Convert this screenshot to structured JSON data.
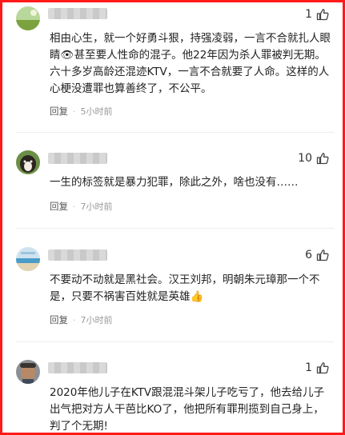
{
  "comments": [
    {
      "likes": "1",
      "text": "相由心生，就一个好勇斗狠，持强凌弱，一言不合就扎人眼睛👁甚至要人性命的混子。他22年因为杀人罪被判无期。六十多岁高龄还混迹KTV，一言不合就要了人命。这样的人心梗没遭罪也算善终了，不公平。",
      "reply": "回复",
      "time": "5小时前"
    },
    {
      "likes": "10",
      "text": "一生的标签就是暴力犯罪，除此之外，啥也没有……",
      "reply": "回复",
      "time": "7小时前"
    },
    {
      "likes": "6",
      "text": "不要动不动就是黑社会。汉王刘邦，明朝朱元璋那一个不是，只要不祸害百姓就是英雄👍",
      "reply": "回复",
      "time": "7小时前"
    },
    {
      "likes": "1",
      "text": "2020年他儿子在KTV跟混混斗架儿子吃亏了，他去给儿子出气把对方人干芭比KO了，他把所有罪刑揽到自己身上，判了个无期!",
      "reply": "",
      "time": ""
    }
  ],
  "colors": {
    "frame": "#ff1a1a",
    "meta": "#999999"
  },
  "icons": {
    "like": "thumbs-up-icon"
  }
}
